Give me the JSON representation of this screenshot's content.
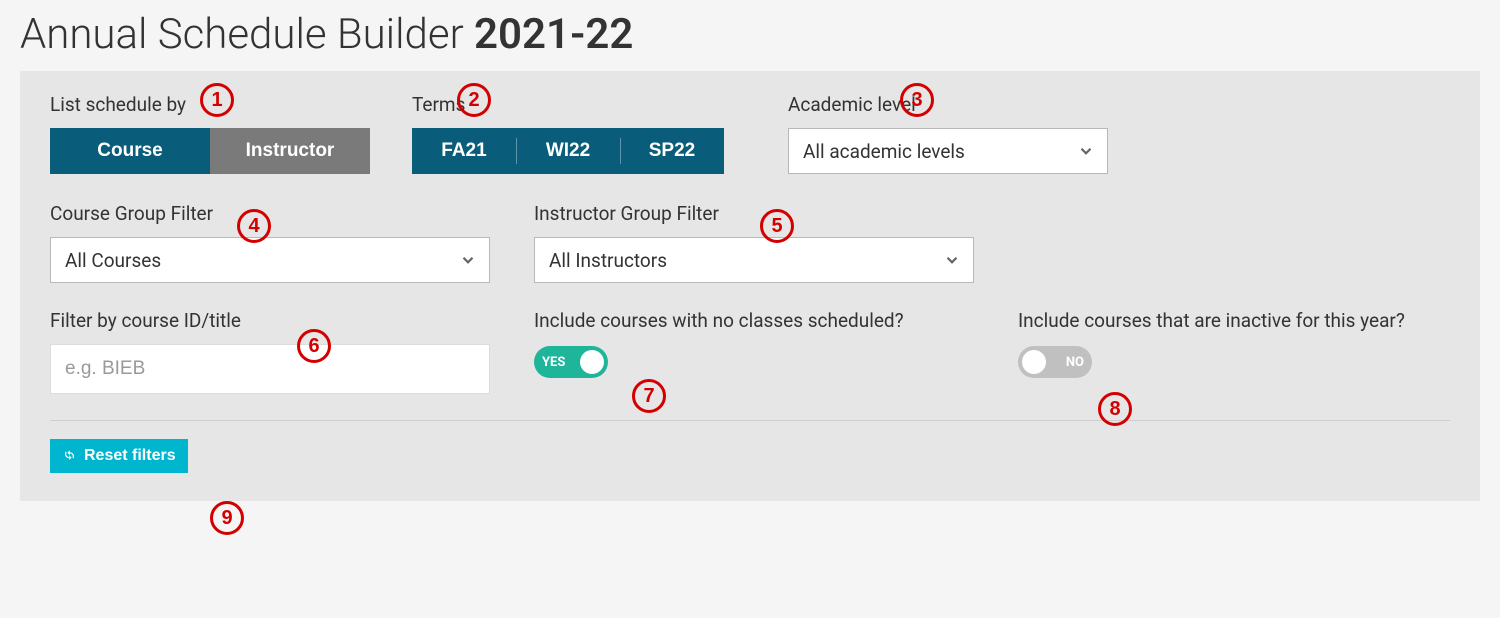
{
  "title": {
    "prefix": "Annual Schedule Builder ",
    "year": "2021-22"
  },
  "list_by": {
    "label": "List schedule by",
    "options": [
      "Course",
      "Instructor"
    ],
    "active_index": 0
  },
  "terms": {
    "label": "Terms",
    "items": [
      "FA21",
      "WI22",
      "SP22"
    ]
  },
  "academic_level": {
    "label": "Academic level",
    "value": "All academic levels"
  },
  "course_group": {
    "label": "Course Group Filter",
    "value": "All Courses"
  },
  "instructor_group": {
    "label": "Instructor Group Filter",
    "value": "All Instructors"
  },
  "course_id_filter": {
    "label": "Filter by course ID/title",
    "placeholder": "e.g. BIEB",
    "value": ""
  },
  "include_no_classes": {
    "label": "Include courses with no classes scheduled?",
    "on_label": "YES",
    "off_label": "NO",
    "value": true
  },
  "include_inactive": {
    "label": "Include courses that are inactive for this year?",
    "on_label": "YES",
    "off_label": "NO",
    "value": false
  },
  "reset_button": "Reset filters",
  "callouts": [
    "1",
    "2",
    "3",
    "4",
    "5",
    "6",
    "7",
    "8",
    "9"
  ]
}
